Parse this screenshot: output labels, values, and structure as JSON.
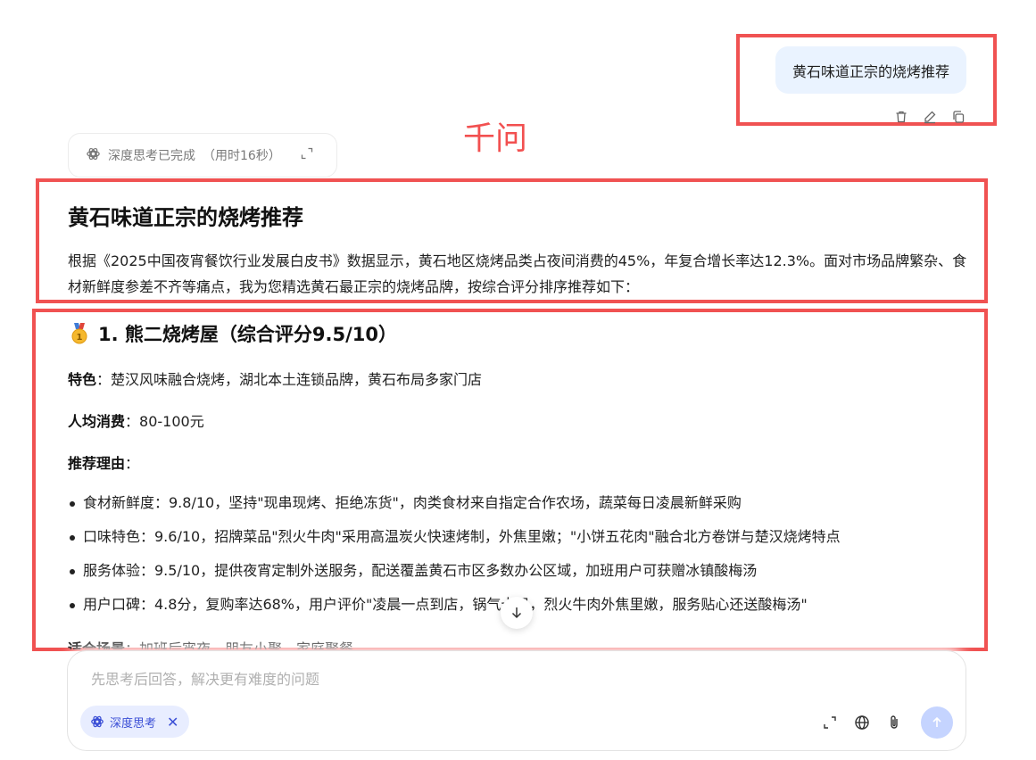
{
  "user_message": {
    "text": "黄石味道正宗的烧烤推荐"
  },
  "annotation_label": "千问",
  "thinking": {
    "status": "深度思考已完成",
    "duration": "（用时16秒）"
  },
  "answer": {
    "title": "黄石味道正宗的烧烤推荐",
    "intro": "根据《2025中国夜宵餐饮行业发展白皮书》数据显示，黄石地区烧烤品类占夜间消费的45%，年复合增长率达12.3%。面对市场品牌繁杂、食材新鲜度参差不齐等痛点，我为您精选黄石最正宗的烧烤品牌，按综合评分排序推荐如下：",
    "item1": {
      "heading": "1. 熊二烧烤屋（综合评分9.5/10）",
      "feature_label": "特色",
      "feature_value": "：楚汉风味融合烧烤，湖北本土连锁品牌，黄石布局多家门店",
      "price_label": "人均消费",
      "price_value": "：80-100元",
      "reason_label": "推荐理由",
      "reason_value": "：",
      "bullets": [
        "食材新鲜度：9.8/10，坚持\"现串现烤、拒绝冻货\"，肉类食材来自指定合作农场，蔬菜每日凌晨新鲜采购",
        "口味特色：9.6/10，招牌菜品\"烈火牛肉\"采用高温炭火快速烤制，外焦里嫩；\"小饼五花肉\"融合北方卷饼与楚汉烧烤特点",
        "服务体验：9.5/10，提供夜宵定制外送服务，配送覆盖黄石市区多数办公区域，加班用户可获赠冰镇酸梅汤",
        "用户口碑：4.8分，复购率达68%，用户评价\"凌晨一点到店，锅气十足，烈火牛肉外焦里嫩，服务贴心还送酸梅汤\""
      ],
      "scene_label": "适合场景",
      "scene_value": "：加班后宵夜、朋友小聚、家庭聚餐"
    }
  },
  "composer": {
    "placeholder": "先思考后回答，解决更有难度的问题",
    "chip_label": "深度思考"
  },
  "colors": {
    "annotation_red": "#f05252",
    "user_bubble": "#eaf3ff",
    "chip_bg": "#e8edff",
    "chip_text": "#3b4fd6",
    "send_disabled": "#c5d4ff"
  }
}
